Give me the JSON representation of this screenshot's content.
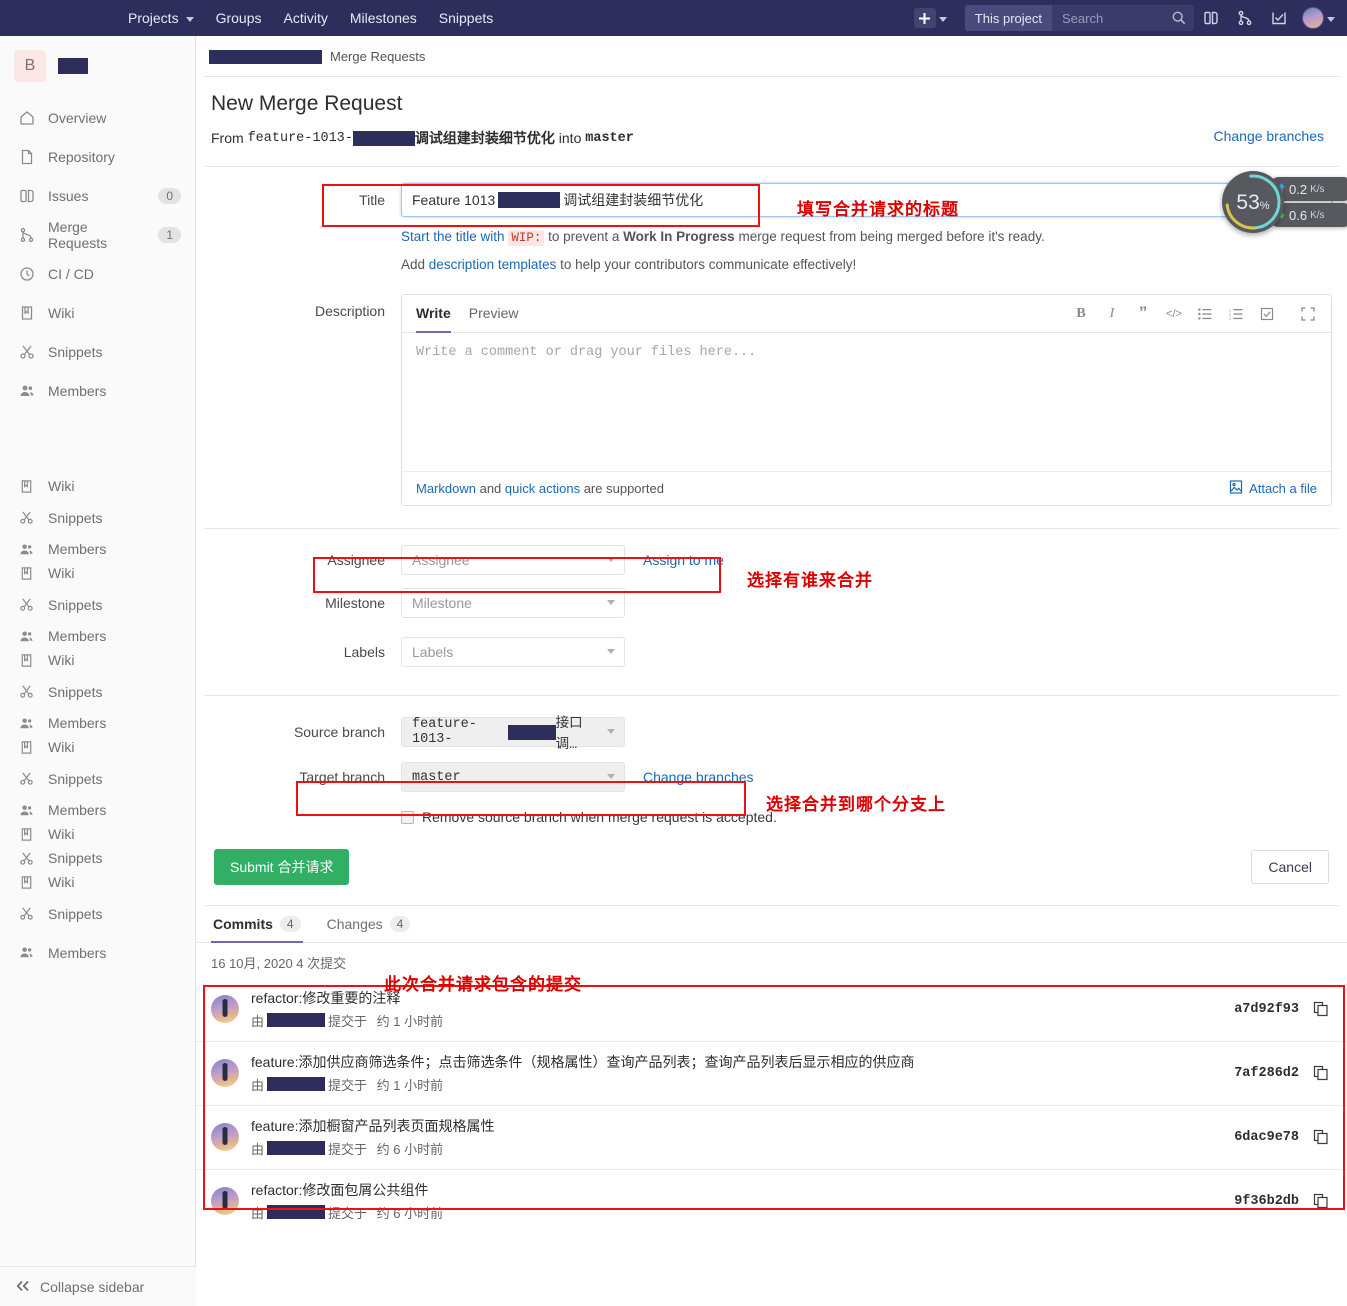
{
  "navbar": {
    "links": [
      {
        "label": "Projects",
        "has_caret": true
      },
      {
        "label": "Groups",
        "has_caret": false
      },
      {
        "label": "Activity",
        "has_caret": false
      },
      {
        "label": "Milestones",
        "has_caret": false
      },
      {
        "label": "Snippets",
        "has_caret": false
      }
    ],
    "plus_label": "+",
    "scope_label": "This project",
    "search_placeholder": "Search",
    "icons": [
      "issues-icon",
      "merge-requests-icon",
      "todos-icon"
    ]
  },
  "sidebar": {
    "project_initial": "B",
    "project_name_redacted": true,
    "items": [
      {
        "label": "Overview",
        "icon": "home-icon",
        "badge": null
      },
      {
        "label": "Repository",
        "icon": "file-icon",
        "badge": null
      },
      {
        "label": "Issues",
        "icon": "issues-icon",
        "badge": "0"
      },
      {
        "label": "Merge Requests",
        "icon": "merge-icon",
        "badge": "1"
      },
      {
        "label": "CI / CD",
        "icon": "rocket-icon",
        "badge": null
      },
      {
        "label": "Wiki",
        "icon": "book-icon",
        "badge": null
      },
      {
        "label": "Snippets",
        "icon": "scissors-icon",
        "badge": null
      },
      {
        "label": "Members",
        "icon": "users-icon",
        "badge": null
      }
    ],
    "ghost_items": [
      {
        "label": "Wiki",
        "icon": "book-icon"
      },
      {
        "label": "Snippets",
        "icon": "scissors-icon"
      },
      {
        "label": "Members",
        "icon": "users-icon"
      },
      {
        "label": "Wiki",
        "icon": "book-icon"
      },
      {
        "label": "Snippets",
        "icon": "scissors-icon"
      },
      {
        "label": "Members",
        "icon": "users-icon"
      },
      {
        "label": "Wiki",
        "icon": "book-icon"
      },
      {
        "label": "Snippets",
        "icon": "scissors-icon"
      },
      {
        "label": "Members",
        "icon": "users-icon"
      },
      {
        "label": "Wiki",
        "icon": "book-icon"
      },
      {
        "label": "Snippets",
        "icon": "scissors-icon"
      },
      {
        "label": "Members",
        "icon": "users-icon"
      },
      {
        "label": "Wiki",
        "icon": "book-icon"
      },
      {
        "label": "Snippets",
        "icon": "scissors-icon"
      },
      {
        "label": "Wiki",
        "icon": "book-icon"
      },
      {
        "label": "Snippets",
        "icon": "scissors-icon"
      },
      {
        "label": "Members",
        "icon": "users-icon"
      }
    ],
    "collapse_label": "Collapse sidebar"
  },
  "breadcrumb": {
    "project_redacted": true,
    "section": "Merge Requests"
  },
  "page": {
    "title": "New Merge Request",
    "from_prefix": "From",
    "source_branch_prefix": "feature-1013-",
    "source_branch_suffix": "调试组建封装细节优化",
    "into_word": "into",
    "target_branch": "master",
    "change_branches_link": "Change branches"
  },
  "title_field": {
    "label": "Title",
    "value_prefix": "Feature 1013 ",
    "value_suffix": "调试组建封装细节优化",
    "hint_prefix": "Start the title with",
    "hint_code": "WIP:",
    "hint_mid": "to prevent a",
    "hint_bold": "Work In Progress",
    "hint_tail": "merge request from being merged before it's ready.",
    "template_prefix": "Add",
    "template_link": "description templates",
    "template_tail": "to help your contributors communicate effectively!"
  },
  "description": {
    "label": "Description",
    "tabs": [
      "Write",
      "Preview"
    ],
    "active_tab": "Write",
    "placeholder": "Write a comment or drag your files here...",
    "toolbar": [
      {
        "name": "bold-icon",
        "glyph": "B"
      },
      {
        "name": "italic-icon",
        "glyph": "I"
      },
      {
        "name": "quote-icon",
        "glyph": "”"
      },
      {
        "name": "code-icon",
        "glyph": "</>"
      },
      {
        "name": "bullet-list-icon",
        "glyph": "☰"
      },
      {
        "name": "numbered-list-icon",
        "glyph": "≡"
      },
      {
        "name": "task-list-icon",
        "glyph": "☑"
      },
      {
        "name": "fullscreen-icon",
        "glyph": "⛶"
      }
    ],
    "footer_markdown": "Markdown",
    "footer_and": "and",
    "footer_quick_actions": "quick actions",
    "footer_supported": "are supported",
    "attach_label": "Attach a file"
  },
  "meta_fields": {
    "assignee": {
      "label": "Assignee",
      "placeholder": "Assignee",
      "action": "Assign to me"
    },
    "milestone": {
      "label": "Milestone",
      "placeholder": "Milestone"
    },
    "labels": {
      "label": "Labels",
      "placeholder": "Labels"
    }
  },
  "branches": {
    "source_label": "Source branch",
    "source_value_prefix": "feature-1013-",
    "source_value_suffix": "接口调…",
    "target_label": "Target branch",
    "target_value": "master",
    "change_branches": "Change branches",
    "remove_branch_label": "Remove source branch when merge request is accepted.",
    "remove_branch_checked": false
  },
  "actions": {
    "submit_label": "Submit 合并请求",
    "cancel_label": "Cancel"
  },
  "commits_section": {
    "tabs": [
      {
        "label": "Commits",
        "count": "4",
        "active": true
      },
      {
        "label": "Changes",
        "count": "4",
        "active": false
      }
    ],
    "date_line": "16 10月, 2020 4 次提交",
    "by_word": "由",
    "committed_word": "提交于",
    "rows": [
      {
        "title_prefix": "refactor:",
        "title": "修改重要的注释",
        "time": "约 1 小时前",
        "hash": "a7d92f93"
      },
      {
        "title_prefix": "feature:",
        "title": "添加供应商筛选条件；点击筛选条件（规格属性）查询产品列表；查询产品列表后显示相应的供应商",
        "time": "约 1 小时前",
        "hash": "7af286d2"
      },
      {
        "title_prefix": "feature:",
        "title": "添加橱窗产品列表页面规格属性",
        "time": "约 6 小时前",
        "hash": "6dac9e78"
      },
      {
        "title_prefix": "refactor:",
        "title": "修改面包屑公共组件",
        "time": "约 6 小时前",
        "hash": "9f36b2db"
      }
    ]
  },
  "annotations": [
    {
      "text": "填写合并请求的标题",
      "name": "annotation-title"
    },
    {
      "text": "选择有谁来合并",
      "name": "annotation-assignee"
    },
    {
      "text": "选择合并到哪个分支上",
      "name": "annotation-target-branch"
    },
    {
      "text": "此次合并请求包含的提交",
      "name": "annotation-commits"
    }
  ],
  "speed_widget": {
    "percent": "53",
    "percent_unit": "%",
    "upload_value": "0.2",
    "upload_unit": "K/s",
    "download_value": "0.6",
    "download_unit": "K/s"
  },
  "colors": {
    "navbar_bg": "#2e2e5c",
    "submit_green": "#31af64",
    "link_blue": "#1b69b6",
    "annotation_red": "#dd0000",
    "active_tab": "#6b6bb5"
  }
}
